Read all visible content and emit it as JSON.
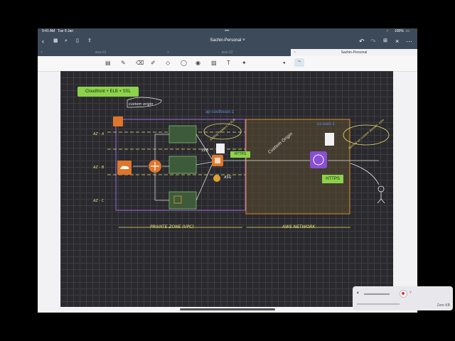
{
  "status_bar": {
    "time": "9:41 AM",
    "date": "Tue 9 Jan",
    "battery": "100%"
  },
  "navbar": {
    "title": "Sachin-Personal"
  },
  "tabs": [
    {
      "label": "aws-01",
      "active": false
    },
    {
      "label": "aws-02",
      "active": false
    },
    {
      "label": "Sachin-Personal",
      "active": true
    }
  ],
  "toolbar": {
    "tools": [
      "pages-icon",
      "pen-icon",
      "eraser-icon",
      "highlighter-icon",
      "shapes-icon",
      "lasso-icon",
      "camera-icon",
      "image-icon",
      "text-icon",
      "laser-icon"
    ]
  },
  "diagram": {
    "cloudfront_box": "Cloudfront + ELB + SSL",
    "custom_origin_note": "custom origin",
    "region_ap": "ap-southeast-1",
    "region_us": "us-east-1",
    "az_a": "AZ - A",
    "az_b": "AZ - B",
    "az_c": "AZ - C",
    "elb": "ELB",
    "asg": "ASG",
    "https_1": "HTTPS",
    "https_2": "HTTPS",
    "setting_headers": "Setting headers in ELB",
    "custom_origin_title": "Custom Origin",
    "custom_domain_note": "Setting up custom domain .com",
    "private_zone": "PRIVATE ZONE (VPC)",
    "aws_network": "AWS NETWORK"
  },
  "recorder": {
    "size": "Zero KB"
  }
}
